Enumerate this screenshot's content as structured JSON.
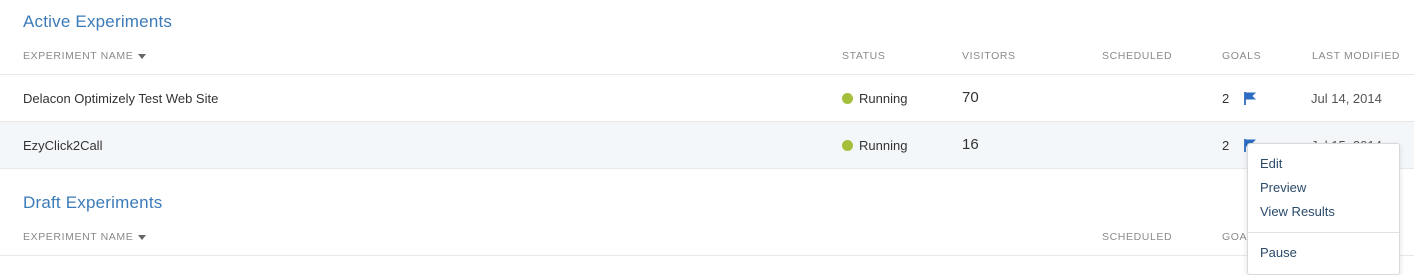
{
  "active": {
    "title": "Active Experiments",
    "headers": {
      "name": "EXPERIMENT NAME",
      "status": "STATUS",
      "visitors": "VISITORS",
      "scheduled": "SCHEDULED",
      "goals": "GOALS",
      "modified": "LAST MODIFIED"
    },
    "rows": [
      {
        "name": "Delacon Optimizely Test Web Site",
        "status": "Running",
        "visitors": "70",
        "goals": "2",
        "modified": "Jul 14, 2014"
      },
      {
        "name": "EzyClick2Call",
        "status": "Running",
        "visitors": "16",
        "goals": "2",
        "modified": "Jul 15, 2014"
      }
    ]
  },
  "draft": {
    "title": "Draft Experiments",
    "headers": {
      "name": "EXPERIMENT NAME",
      "scheduled": "SCHEDULED",
      "goals": "GOALS"
    }
  },
  "menu": {
    "items": [
      "Edit",
      "Preview",
      "View Results",
      "Pause"
    ]
  },
  "colors": {
    "title": "#3b7bb8",
    "running_dot": "#a4c03b",
    "flag": "#2d6cc0",
    "row_hover": "#f4f7fa"
  },
  "icons": {
    "sort": "caret-down-icon",
    "goal": "flag-icon",
    "status": "status-dot-icon"
  }
}
